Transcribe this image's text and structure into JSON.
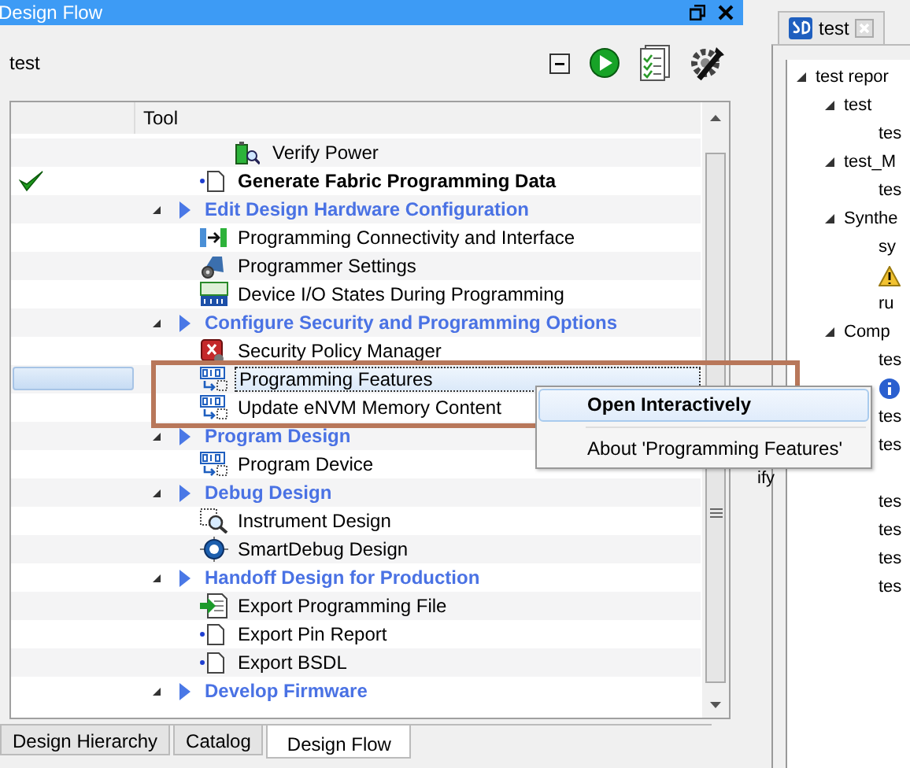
{
  "window": {
    "title": "Design Flow"
  },
  "project": "test",
  "toolbar": {
    "buttons": [
      {
        "kind": "collapse"
      },
      {
        "kind": "run"
      },
      {
        "kind": "report"
      },
      {
        "kind": "settings"
      }
    ]
  },
  "table": {
    "columns": [
      "Tool"
    ],
    "rows": [
      {
        "kind": "subitem",
        "label": "Verify Power",
        "done": false,
        "emphasized": false,
        "selected": false
      },
      {
        "kind": "item",
        "label": "Generate Fabric Programming Data",
        "done": true,
        "emphasized": true,
        "selected": false
      },
      {
        "kind": "group",
        "label": "Edit Design Hardware Configuration",
        "expanded": true,
        "children": [
          {
            "kind": "item",
            "label": "Programming Connectivity and Interface",
            "done": false,
            "emphasized": false,
            "selected": false
          },
          {
            "kind": "item",
            "label": "Programmer Settings",
            "done": false,
            "emphasized": false,
            "selected": false
          },
          {
            "kind": "item",
            "label": "Device I/O States During Programming",
            "done": false,
            "emphasized": false,
            "selected": false
          }
        ]
      },
      {
        "kind": "group",
        "label": "Configure Security and Programming Options",
        "expanded": true,
        "children": [
          {
            "kind": "item",
            "label": "Security Policy Manager",
            "done": false,
            "emphasized": false,
            "selected": false
          },
          {
            "kind": "item",
            "label": "Programming Features",
            "done": false,
            "emphasized": false,
            "selected": true
          },
          {
            "kind": "item",
            "label": "Update eNVM Memory Content",
            "done": false,
            "emphasized": false,
            "selected": false
          }
        ]
      },
      {
        "kind": "group",
        "label": "Program Design",
        "expanded": true,
        "children": [
          {
            "kind": "item",
            "label": "Program Device",
            "done": false,
            "emphasized": false,
            "selected": false
          }
        ]
      },
      {
        "kind": "group",
        "label": "Debug Design",
        "expanded": true,
        "children": [
          {
            "kind": "item",
            "label": "Instrument Design",
            "done": false,
            "emphasized": false,
            "selected": false
          },
          {
            "kind": "item",
            "label": "SmartDebug Design",
            "done": false,
            "emphasized": false,
            "selected": false
          }
        ]
      },
      {
        "kind": "group",
        "label": "Handoff Design for Production",
        "expanded": true,
        "children": [
          {
            "kind": "item",
            "label": "Export Programming File",
            "done": false,
            "emphasized": false,
            "selected": false
          },
          {
            "kind": "item",
            "label": "Export Pin Report",
            "done": false,
            "emphasized": false,
            "selected": false
          },
          {
            "kind": "item",
            "label": "Export BSDL",
            "done": false,
            "emphasized": false,
            "selected": false
          }
        ]
      },
      {
        "kind": "group",
        "label": "Develop Firmware",
        "expanded": true,
        "children": []
      }
    ]
  },
  "context_menu": {
    "items": [
      {
        "label": "Open Interactively",
        "selected": true
      },
      {
        "label": "About 'Programming Features'",
        "selected": false
      }
    ]
  },
  "bottom_tabs": [
    {
      "label": "Design Hierarchy",
      "selected": false
    },
    {
      "label": "Catalog",
      "selected": false
    },
    {
      "label": "Design Flow",
      "selected": true
    }
  ],
  "report_tab": {
    "label": "test"
  },
  "report_tree": [
    {
      "kind": "root",
      "label": "test repor"
    },
    {
      "kind": "node",
      "label": "test"
    },
    {
      "kind": "leaf",
      "label": "tes"
    },
    {
      "kind": "node",
      "label": "test_M"
    },
    {
      "kind": "leaf",
      "label": "tes"
    },
    {
      "kind": "node",
      "label": "Synthe"
    },
    {
      "kind": "leaf",
      "label": "sy"
    },
    {
      "kind": "warning"
    },
    {
      "kind": "leaf",
      "label": "ru"
    },
    {
      "kind": "node",
      "label": "Comp"
    },
    {
      "kind": "leaf",
      "label": "tes"
    },
    {
      "kind": "info"
    },
    {
      "kind": "leaf",
      "label": "tes"
    },
    {
      "kind": "leaf",
      "label": "tes"
    },
    {
      "kind": "stray",
      "label": "ify"
    },
    {
      "kind": "leaf",
      "label": "tes"
    },
    {
      "kind": "leaf",
      "label": "tes"
    },
    {
      "kind": "leaf",
      "label": "tes"
    },
    {
      "kind": "leaf",
      "label": "tes"
    }
  ]
}
